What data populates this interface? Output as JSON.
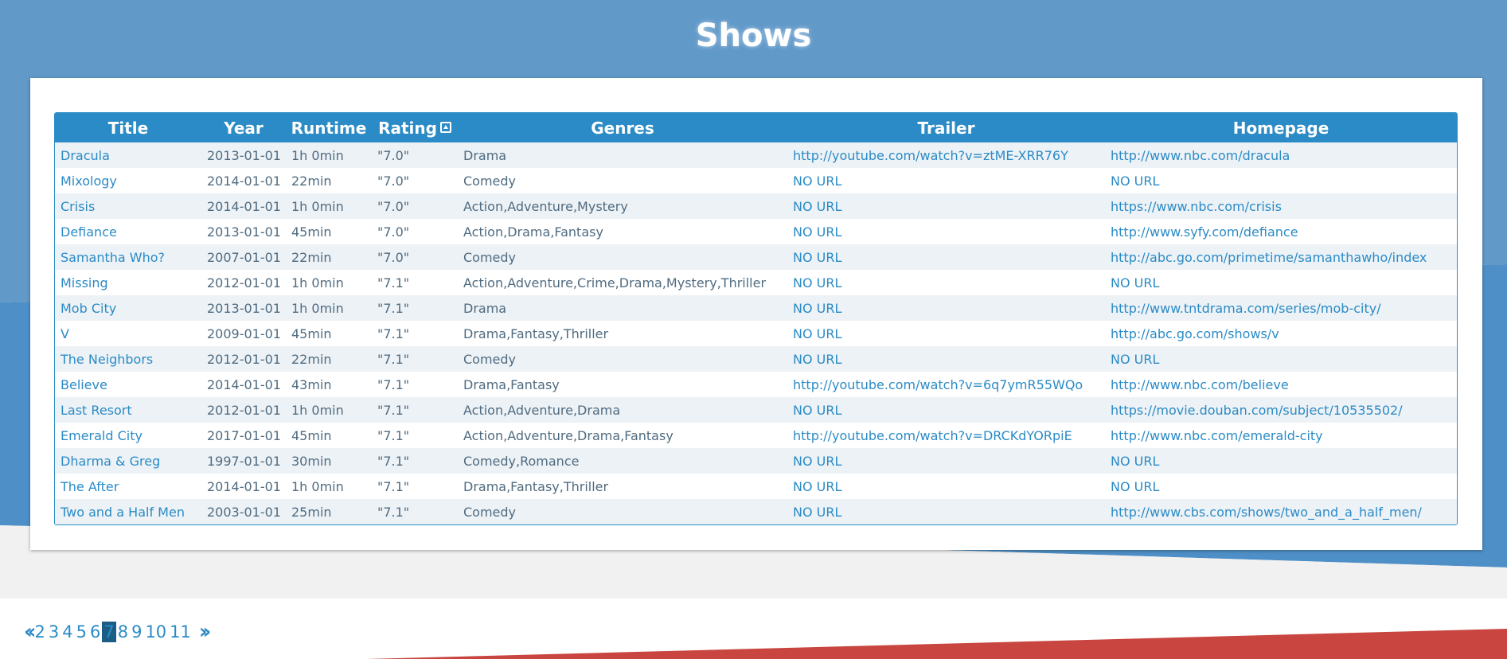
{
  "page": {
    "title": "Shows"
  },
  "colors": {
    "header_bg": "#6199c9",
    "accent": "#2b8bc6",
    "text": "#4f6b80",
    "stripe": "#edf2f6",
    "red_band": "#c8463f",
    "current_page_bg": "#1b5e85"
  },
  "table": {
    "columns": [
      "Title",
      "Year",
      "Runtime",
      "Rating",
      "Genres",
      "Trailer",
      "Homepage"
    ],
    "sort_icon": "sort-ascending-icon",
    "rows": [
      {
        "title": "Dracula",
        "year": "2013-01-01",
        "runtime": "1h 0min",
        "rating": "\"7.0\"",
        "genres": "Drama",
        "trailer": "http://youtube.com/watch?v=ztME-XRR76Y",
        "homepage": "http://www.nbc.com/dracula"
      },
      {
        "title": "Mixology",
        "year": "2014-01-01",
        "runtime": "22min",
        "rating": "\"7.0\"",
        "genres": "Comedy",
        "trailer": "NO URL",
        "homepage": "NO URL"
      },
      {
        "title": "Crisis",
        "year": "2014-01-01",
        "runtime": "1h 0min",
        "rating": "\"7.0\"",
        "genres": "Action,Adventure,Mystery",
        "trailer": "NO URL",
        "homepage": "https://www.nbc.com/crisis"
      },
      {
        "title": "Defiance",
        "year": "2013-01-01",
        "runtime": "45min",
        "rating": "\"7.0\"",
        "genres": "Action,Drama,Fantasy",
        "trailer": "NO URL",
        "homepage": "http://www.syfy.com/defiance"
      },
      {
        "title": "Samantha Who?",
        "year": "2007-01-01",
        "runtime": "22min",
        "rating": "\"7.0\"",
        "genres": "Comedy",
        "trailer": "NO URL",
        "homepage": "http://abc.go.com/primetime/samanthawho/index"
      },
      {
        "title": "Missing",
        "year": "2012-01-01",
        "runtime": "1h 0min",
        "rating": "\"7.1\"",
        "genres": "Action,Adventure,Crime,Drama,Mystery,Thriller",
        "trailer": "NO URL",
        "homepage": "NO URL"
      },
      {
        "title": "Mob City",
        "year": "2013-01-01",
        "runtime": "1h 0min",
        "rating": "\"7.1\"",
        "genres": "Drama",
        "trailer": "NO URL",
        "homepage": "http://www.tntdrama.com/series/mob-city/"
      },
      {
        "title": "V",
        "year": "2009-01-01",
        "runtime": "45min",
        "rating": "\"7.1\"",
        "genres": "Drama,Fantasy,Thriller",
        "trailer": "NO URL",
        "homepage": "http://abc.go.com/shows/v"
      },
      {
        "title": "The Neighbors",
        "year": "2012-01-01",
        "runtime": "22min",
        "rating": "\"7.1\"",
        "genres": "Comedy",
        "trailer": "NO URL",
        "homepage": "NO URL"
      },
      {
        "title": "Believe",
        "year": "2014-01-01",
        "runtime": "43min",
        "rating": "\"7.1\"",
        "genres": "Drama,Fantasy",
        "trailer": "http://youtube.com/watch?v=6q7ymR55WQo",
        "homepage": "http://www.nbc.com/believe"
      },
      {
        "title": "Last Resort",
        "year": "2012-01-01",
        "runtime": "1h 0min",
        "rating": "\"7.1\"",
        "genres": "Action,Adventure,Drama",
        "trailer": "NO URL",
        "homepage": "https://movie.douban.com/subject/10535502/"
      },
      {
        "title": "Emerald City",
        "year": "2017-01-01",
        "runtime": "45min",
        "rating": "\"7.1\"",
        "genres": "Action,Adventure,Drama,Fantasy",
        "trailer": "http://youtube.com/watch?v=DRCKdYORpiE",
        "homepage": "http://www.nbc.com/emerald-city"
      },
      {
        "title": "Dharma & Greg",
        "year": "1997-01-01",
        "runtime": "30min",
        "rating": "\"7.1\"",
        "genres": "Comedy,Romance",
        "trailer": "NO URL",
        "homepage": "NO URL"
      },
      {
        "title": "The After",
        "year": "2014-01-01",
        "runtime": "1h 0min",
        "rating": "\"7.1\"",
        "genres": "Drama,Fantasy,Thriller",
        "trailer": "NO URL",
        "homepage": "NO URL"
      },
      {
        "title": "Two and a Half Men",
        "year": "2003-01-01",
        "runtime": "25min",
        "rating": "\"7.1\"",
        "genres": "Comedy",
        "trailer": "NO URL",
        "homepage": "http://www.cbs.com/shows/two_and_a_half_men/"
      }
    ]
  },
  "pagination": {
    "prev_icon": "double-chevron-left-icon",
    "next_icon": "double-chevron-right-icon",
    "pages": [
      "2",
      "3",
      "4",
      "5",
      "6",
      "7",
      "8",
      "9",
      "10",
      "11"
    ],
    "current": "7"
  }
}
